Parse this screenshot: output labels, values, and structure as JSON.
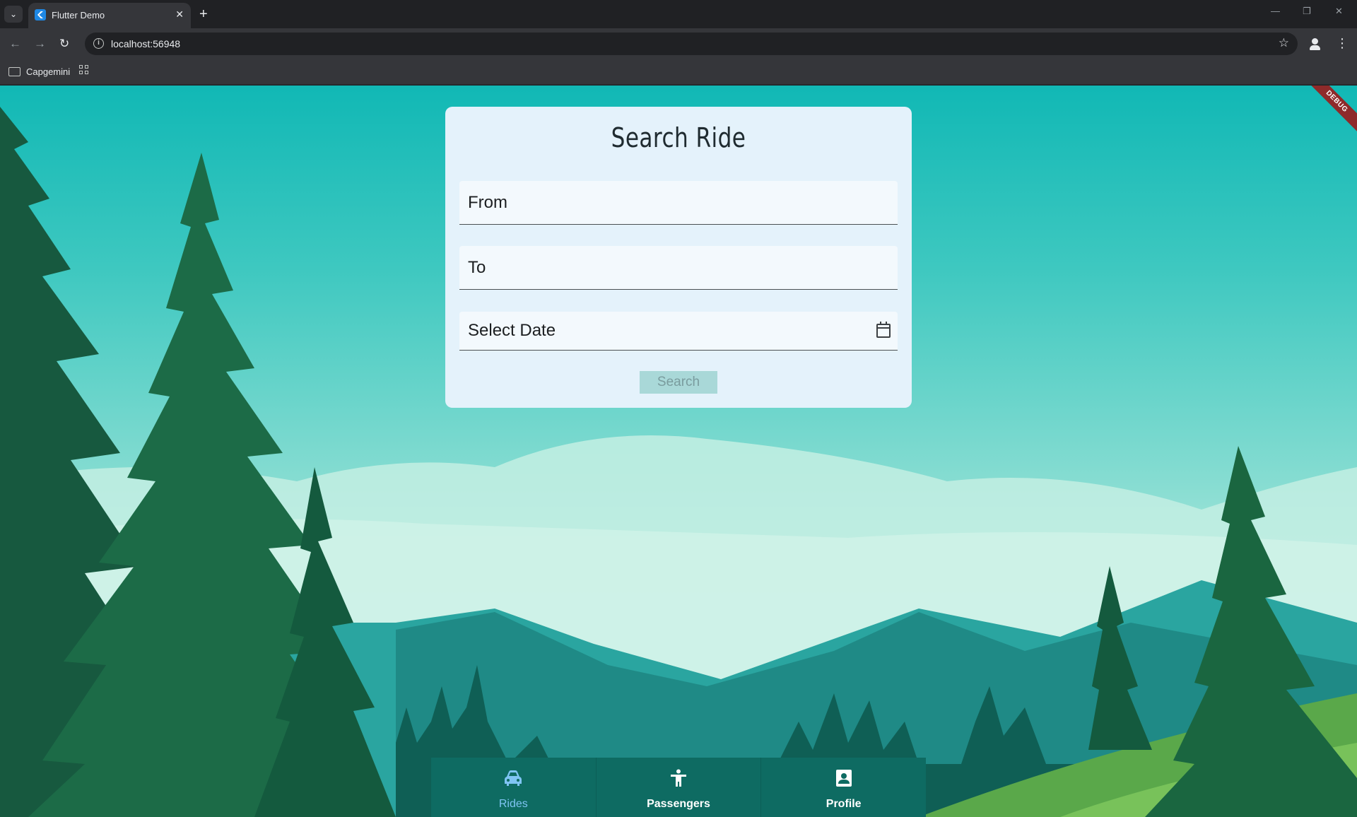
{
  "browser": {
    "tab_title": "Flutter Demo",
    "tab_close": "✕",
    "new_tab": "+",
    "tab_list": "⌄",
    "url": "localhost:56948",
    "nav": {
      "back": "←",
      "forward": "→",
      "reload": "↻"
    },
    "star": "☆",
    "menu": "⋮",
    "window": {
      "minimize": "—",
      "restore": "❐",
      "close": "✕"
    },
    "bookmarks": [
      {
        "label": "Capgemini"
      }
    ]
  },
  "debug_banner": "DEBUG",
  "card": {
    "title": "Search Ride",
    "from_label": "From",
    "to_label": "To",
    "date_label": "Select Date",
    "search_button": "Search"
  },
  "bottom_nav": {
    "items": [
      {
        "label": "Rides",
        "icon": "car-icon",
        "selected": true
      },
      {
        "label": "Passengers",
        "icon": "accessibility-icon",
        "selected": false
      },
      {
        "label": "Profile",
        "icon": "profile-icon",
        "selected": false
      }
    ]
  },
  "colors": {
    "nav_background": "#0e6b62",
    "nav_selected": "#7fc4f3",
    "card_background": "#e4f2fb",
    "search_button": "#a9d8d8"
  }
}
